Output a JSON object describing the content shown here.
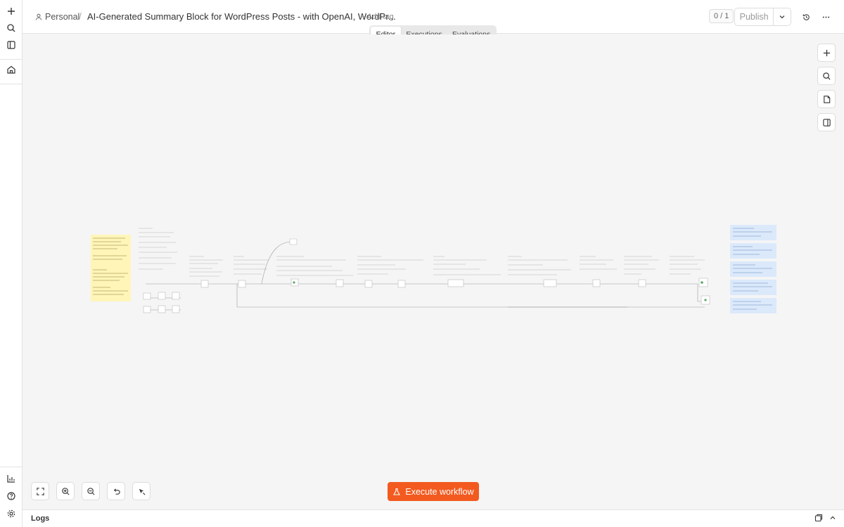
{
  "breadcrumb": {
    "project": "Personal",
    "separator": "/"
  },
  "workflow": {
    "title": "AI-Generated Summary Block for WordPress Posts - with OpenAI, WordPr...",
    "add_tag": "+ Add tag"
  },
  "version": {
    "counter": "0 / 1"
  },
  "publish": {
    "label": "Publish"
  },
  "tabs": [
    {
      "label": "Editor",
      "active": true
    },
    {
      "label": "Executions",
      "active": false
    },
    {
      "label": "Evaluations",
      "active": false
    }
  ],
  "execute": {
    "label": "Execute workflow"
  },
  "logs": {
    "label": "Logs"
  },
  "colors": {
    "accent": "#f35a1f",
    "sticky_yellow": "#fff5b8",
    "sticky_blue": "#dbe9fb"
  }
}
